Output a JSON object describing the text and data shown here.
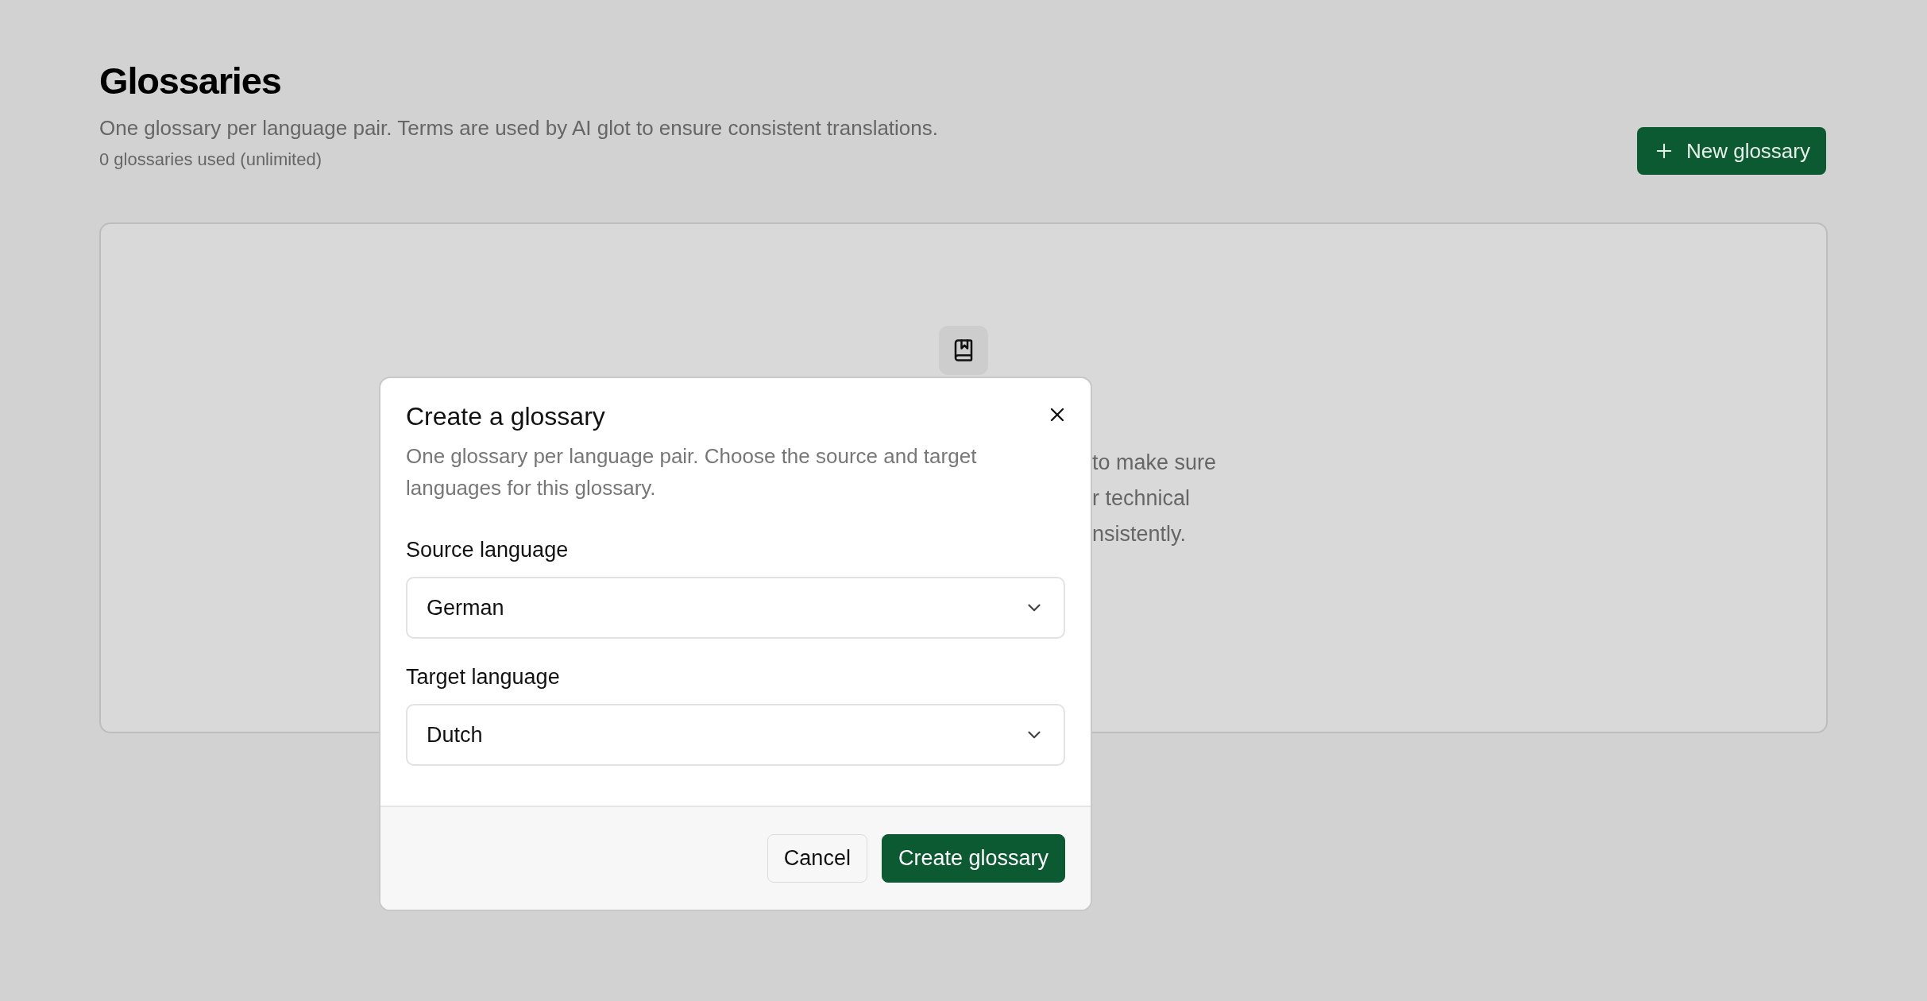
{
  "page": {
    "title": "Glossaries",
    "description": "One glossary per language pair. Terms are used by AI glot to ensure consistent translations.",
    "usage": "0 glossaries used (unlimited)",
    "new_button": "New glossary"
  },
  "empty_state": {
    "lines": [
      "to make sure",
      "r technical",
      "nsistently."
    ]
  },
  "dialog": {
    "title": "Create a glossary",
    "description": "One glossary per language pair. Choose the source and target languages for this glossary.",
    "fields": [
      {
        "label": "Source language",
        "value": "German"
      },
      {
        "label": "Target language",
        "value": "Dutch"
      }
    ],
    "buttons": [
      {
        "label": "Cancel",
        "kind": "secondary"
      },
      {
        "label": "Create glossary",
        "kind": "primary"
      }
    ]
  }
}
